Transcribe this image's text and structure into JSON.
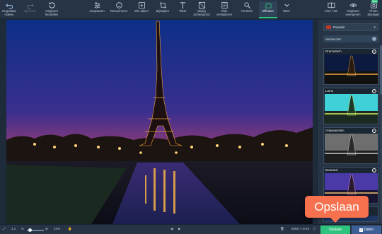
{
  "toolbar": {
    "undo": "Ongedaan\nmaken",
    "redo": "Opnieuw",
    "reset": "Origineel\nherstellen",
    "adjust": "Aanpassen",
    "retouch": "Retoucheren",
    "erase": "Wis object",
    "crop": "Bijsnijden",
    "text": "Tekst",
    "replace_bg": "Wijzig\nachtergrond",
    "noise": "Ruis\nverwijderen",
    "tools": "Hersteln",
    "effects": "Effecten",
    "more": "Meer",
    "before_after": "Voor / Na",
    "original": "Origineel\nweergeven",
    "photo_manager": "Photo\nManager",
    "new_badge": "New"
  },
  "panel": {
    "collection": "Populair",
    "more_effects": "Verras me!",
    "effects": [
      {
        "name": "Dramatisch"
      },
      {
        "name": "Lomo"
      },
      {
        "name": "Grijswaarden"
      },
      {
        "name": "Bonnard"
      }
    ]
  },
  "bottom": {
    "ratio": "1:1",
    "zoom": "22%",
    "dimensions": "5066 × 3719",
    "save": "Opslaan",
    "share": "Delen",
    "facebook_glyph": "f"
  },
  "callout": {
    "text": "Opslaan"
  },
  "colors": {
    "accent": "#2ec27e",
    "share": "#3d5f96",
    "callout": "#f7714f",
    "toolbar_bg": "#263445"
  }
}
